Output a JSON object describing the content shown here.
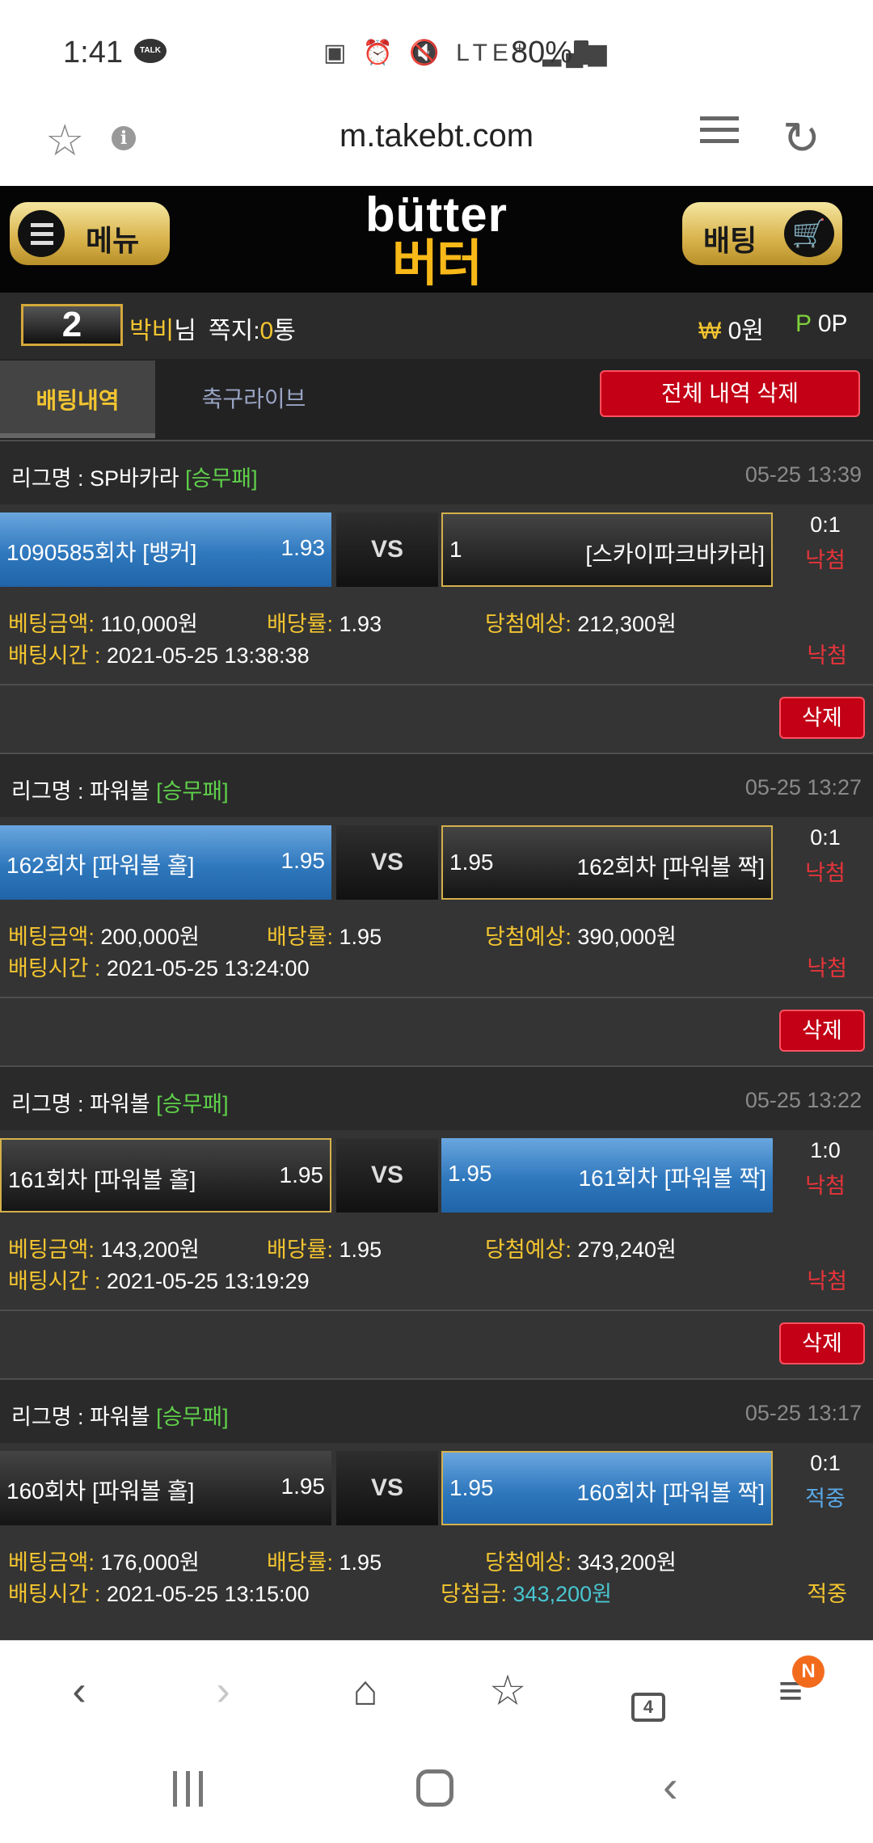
{
  "status_bar": {
    "time": "1:41",
    "talk_icon_label": "TALK",
    "network": "LTE⁺",
    "battery": "80%"
  },
  "browser": {
    "url": "m.takebt.com",
    "tab_count": "4",
    "menu_badge": "N"
  },
  "header": {
    "menu_label": "메뉴",
    "bet_label": "배팅",
    "logo_en": "bütter",
    "logo_kr": "버터"
  },
  "user": {
    "level": "2",
    "name": "박비",
    "name_suffix": "님",
    "messages_label": "쪽지:",
    "messages_count": "0",
    "messages_unit": "통",
    "won_symbol": "₩",
    "won_amount": "0원",
    "point_symbol": "P",
    "point_amount": "0P"
  },
  "tabs": {
    "active": "배팅내역",
    "inactive": "축구라이브",
    "delete_all": "전체 내역 삭제"
  },
  "labels": {
    "league": "리그명 : ",
    "vs": "VS",
    "bet_amount": "베팅금액: ",
    "odds": "배당률: ",
    "expected": "당첨예상: ",
    "bet_time": "배팅시간 : ",
    "win_amount": "당첨금: ",
    "delete": "삭제"
  },
  "colors": {
    "accent_gold": "#f3c530",
    "lose_red": "#e5343a",
    "win_blue": "#59a8e6",
    "league_green": "#5fd04a"
  },
  "bets": [
    {
      "league": "SP바카라",
      "type": "[승무패]",
      "datetime": "05-25 13:39",
      "home_name": "1090585회차 [뱅커]",
      "home_odds": "1.93",
      "away_odds": "1",
      "away_name": "[스카이파크바카라]",
      "score": "0:1",
      "result": "낙첨",
      "amount": "110,000원",
      "odds": "1.93",
      "expected": "212,300원",
      "time": "2021-05-25 13:38:38",
      "status": "낙첨"
    },
    {
      "league": "파워볼",
      "type": "[승무패]",
      "datetime": "05-25 13:27",
      "home_name": "162회차 [파워볼 홀]",
      "home_odds": "1.95",
      "away_odds": "1.95",
      "away_name": "162회차 [파워볼 짝]",
      "score": "0:1",
      "result": "낙첨",
      "amount": "200,000원",
      "odds": "1.95",
      "expected": "390,000원",
      "time": "2021-05-25 13:24:00",
      "status": "낙첨"
    },
    {
      "league": "파워볼",
      "type": "[승무패]",
      "datetime": "05-25 13:22",
      "home_name": "161회차 [파워볼 홀]",
      "home_odds": "1.95",
      "away_odds": "1.95",
      "away_name": "161회차 [파워볼 짝]",
      "score": "1:0",
      "result": "낙첨",
      "amount": "143,200원",
      "odds": "1.95",
      "expected": "279,240원",
      "time": "2021-05-25 13:19:29",
      "status": "낙첨"
    },
    {
      "league": "파워볼",
      "type": "[승무패]",
      "datetime": "05-25 13:17",
      "home_name": "160회차 [파워볼 홀]",
      "home_odds": "1.95",
      "away_odds": "1.95",
      "away_name": "160회차 [파워볼 짝]",
      "score": "0:1",
      "result": "적중",
      "amount": "176,000원",
      "odds": "1.95",
      "expected": "343,200원",
      "time": "2021-05-25 13:15:00",
      "win_amount": "343,200원",
      "status": "적중"
    }
  ]
}
